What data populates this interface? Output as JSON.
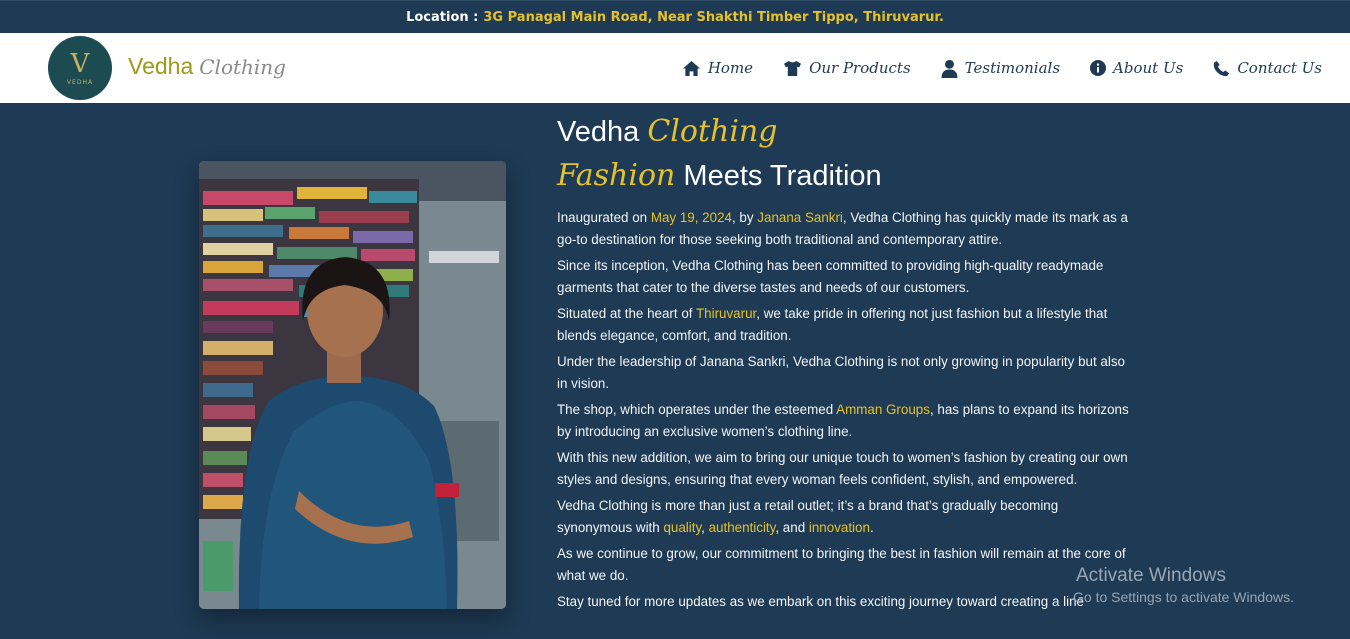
{
  "topbar": {
    "label": "Location :",
    "address": "3G Panagal Main Road, Near Shakthi Timber Tippo, Thiruvarur."
  },
  "logo": {
    "mark": "V",
    "small_text": "VEDHA"
  },
  "brand": {
    "name": "Vedha",
    "script": "Clothing"
  },
  "nav": [
    {
      "label": "Home",
      "icon": "home-icon"
    },
    {
      "label": "Our Products",
      "icon": "shirt-icon"
    },
    {
      "label": "Testimonials",
      "icon": "user-icon"
    },
    {
      "label": "About Us",
      "icon": "info-icon"
    },
    {
      "label": "Contact Us",
      "icon": "phone-icon"
    }
  ],
  "heading": {
    "line1_plain": "Vedha",
    "line1_script": "Clothing",
    "line2_script": "Fashion",
    "line2_plain": "Meets Tradition"
  },
  "paragraphs": {
    "p1": {
      "a": "Inaugurated on ",
      "date": "May 19, 2024",
      "b": ", by ",
      "name": "Janana Sankri",
      "c": ", Vedha Clothing has quickly made its mark as a go-to destination for those seeking both traditional and contemporary attire."
    },
    "p2": "Since its inception, Vedha Clothing has been committed to providing high-quality readymade garments that cater to the diverse tastes and needs of our customers.",
    "p3": {
      "a": "Situated at the heart of ",
      "place": "Thiruvarur",
      "b": ", we take pride in offering not just fashion but a lifestyle that blends elegance, comfort, and tradition."
    },
    "p4": "Under the leadership of Janana Sankri, Vedha Clothing is not only growing in popularity but also in vision.",
    "p5": {
      "a": "The shop, which operates under the esteemed ",
      "group": "Amman Groups",
      "b": ", has plans to expand its horizons by introducing an exclusive women’s clothing line."
    },
    "p6": "With this new addition, we aim to bring our unique touch to women’s fashion by creating our own styles and designs, ensuring that every woman feels confident, stylish, and empowered.",
    "p7": {
      "a": "Vedha Clothing is more than just a retail outlet; it’s a brand that’s gradually becoming synonymous with ",
      "q": "quality",
      "sep1": ", ",
      "au": "authenticity",
      "sep2": ", and ",
      "inn": "innovation",
      "end": "."
    },
    "p8": "As we continue to grow, our commitment to bringing the best in fashion will remain at the core of what we do.",
    "p9": "Stay tuned for more updates as we embark on this exciting journey toward creating a line"
  },
  "watermark": {
    "title": "Activate Windows",
    "subtitle": "Go to Settings to activate Windows."
  },
  "colors": {
    "background": "#1e3a54",
    "accent": "#e6c229",
    "nav_text": "#1e3a54",
    "brand_olive": "#9c9a16"
  }
}
